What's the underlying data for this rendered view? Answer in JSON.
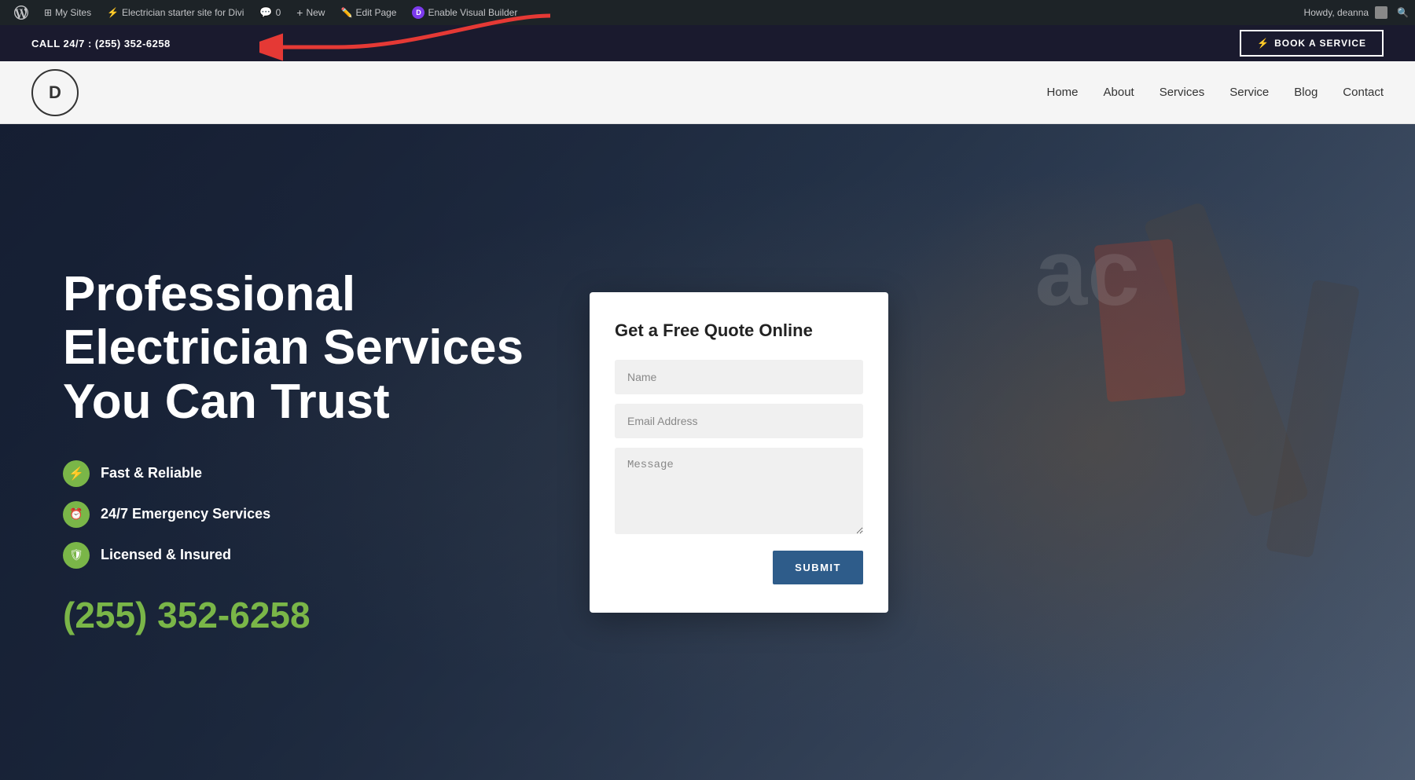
{
  "admin_bar": {
    "wordpress_icon": "⊞",
    "my_sites_label": "My Sites",
    "site_name": "Electrician starter site for Divi",
    "comments_label": "0",
    "new_label": "New",
    "edit_page_label": "Edit Page",
    "enable_vb_label": "Enable Visual Builder",
    "howdy_label": "Howdy, deanna",
    "search_icon": "🔍"
  },
  "top_bar": {
    "phone_label": "CALL 24/7 : (255) 352-6258",
    "book_btn_icon": "⚡",
    "book_btn_label": "BOOK A SERVICE"
  },
  "nav": {
    "logo_text": "D",
    "links": [
      {
        "label": "Home"
      },
      {
        "label": "About"
      },
      {
        "label": "Services"
      },
      {
        "label": "Service"
      },
      {
        "label": "Blog"
      },
      {
        "label": "Contact"
      }
    ]
  },
  "hero": {
    "title_line1": "Professional",
    "title_line2": "Electrician Services",
    "title_line3": "You Can Trust",
    "features": [
      {
        "icon": "⚡",
        "text": "Fast & Reliable"
      },
      {
        "icon": "⏰",
        "text": "24/7 Emergency Services"
      },
      {
        "icon": "🛡",
        "text": "Licensed & Insured"
      }
    ],
    "phone": "(255) 352-6258"
  },
  "quote_form": {
    "title": "Get a Free Quote Online",
    "name_placeholder": "Name",
    "email_placeholder": "Email Address",
    "message_placeholder": "Message",
    "submit_label": "SUBMIT"
  }
}
